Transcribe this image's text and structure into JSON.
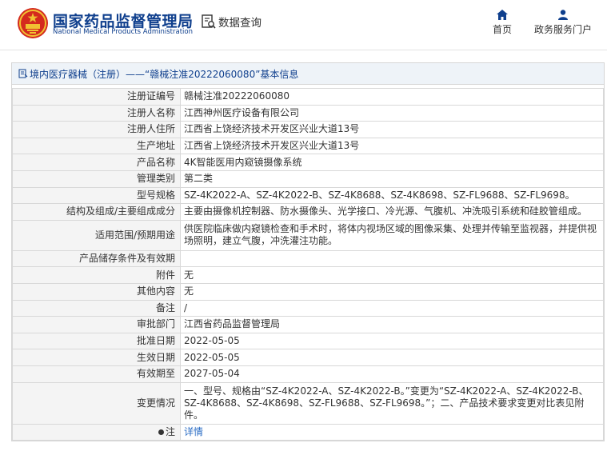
{
  "header": {
    "site_title": "国家药品监督管理局",
    "site_subtitle": "National Medical Products Administration",
    "query_label": "数据查询",
    "nav": {
      "home": "首页",
      "portal": "政务服务门户"
    }
  },
  "panel": {
    "title": "境内医疗器械（注册）——“赣械注准20222060080”基本信息"
  },
  "rows": [
    {
      "label": "注册证编号",
      "value": "赣械注准20222060080"
    },
    {
      "label": "注册人名称",
      "value": "江西神州医疗设备有限公司"
    },
    {
      "label": "注册人住所",
      "value": "江西省上饶经济技术开发区兴业大道13号"
    },
    {
      "label": "生产地址",
      "value": "江西省上饶经济技术开发区兴业大道13号"
    },
    {
      "label": "产品名称",
      "value": "4K智能医用内窥镜摄像系统"
    },
    {
      "label": "管理类别",
      "value": "第二类"
    },
    {
      "label": "型号规格",
      "value": "SZ-4K2022-A、SZ-4K2022-B、SZ-4K8688、SZ-4K8698、SZ-FL9688、SZ-FL9698。"
    },
    {
      "label": "结构及组成/主要组成成分",
      "value": "主要由摄像机控制器、防水摄像头、光学接口、冷光源、气腹机、冲洗吸引系统和硅胶管组成。"
    },
    {
      "label": "适用范围/预期用途",
      "value": "供医院临床做内窥镜检查和手术时，将体内视场区域的图像采集、处理并传输至监视器，并提供视场照明，建立气腹，冲洗灌注功能。"
    },
    {
      "label": "产品储存条件及有效期",
      "value": ""
    },
    {
      "label": "附件",
      "value": "无"
    },
    {
      "label": "其他内容",
      "value": "无"
    },
    {
      "label": "备注",
      "value": "/"
    },
    {
      "label": "审批部门",
      "value": "江西省药品监督管理局"
    },
    {
      "label": "批准日期",
      "value": "2022-05-05"
    },
    {
      "label": "生效日期",
      "value": "2022-05-05"
    },
    {
      "label": "有效期至",
      "value": "2027-05-04"
    },
    {
      "label": "变更情况",
      "value": "一、型号、规格由“SZ-4K2022-A、SZ-4K2022-B。”变更为“SZ-4K2022-A、SZ-4K2022-B、SZ-4K8688、SZ-4K8698、SZ-FL9688、SZ-FL9698。”；二、产品技术要求变更对比表见附件。"
    }
  ],
  "note": {
    "label": "注",
    "link_text": "详情"
  },
  "colors": {
    "brand_blue": "#0f3f8d",
    "emblem_red": "#d42a1e",
    "emblem_gold": "#f1c232",
    "link": "#2a6cc4"
  }
}
